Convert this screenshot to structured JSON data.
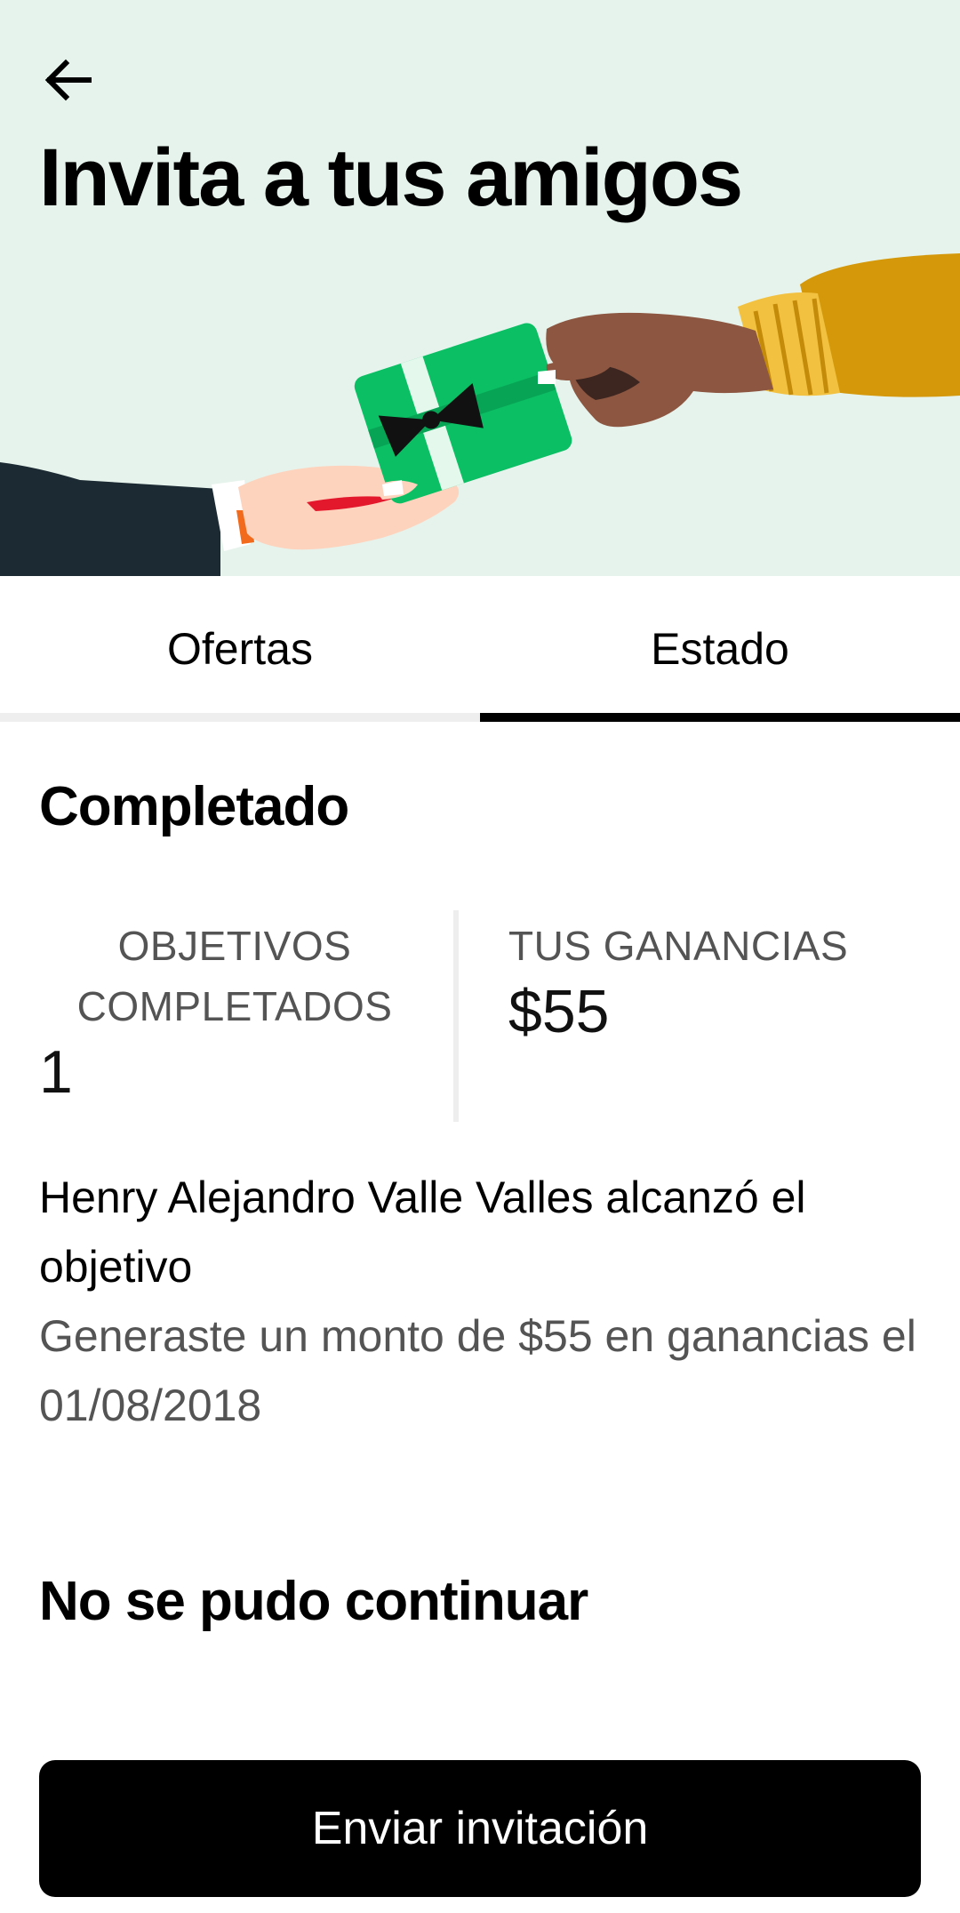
{
  "header": {
    "back_icon": "arrow-left-icon",
    "title": "Invita a tus amigos",
    "background_color": "#e6f3ec"
  },
  "tabs": [
    {
      "label": "Ofertas",
      "active": false
    },
    {
      "label": "Estado",
      "active": true
    }
  ],
  "completed_section": {
    "heading": "Completado",
    "stats": {
      "goals_label": "OBJETIVOS COMPLETADOS",
      "goals_value": "1",
      "earnings_label": "TUS GANANCIAS",
      "earnings_value": "$55"
    },
    "referral": {
      "title": "Henry Alejandro Valle Valles alcanzó el objetivo",
      "detail": "Generaste un monto de $55 en ganancias el 01/08/2018"
    }
  },
  "failed_section": {
    "heading": "No se pudo continuar"
  },
  "cta": {
    "label": "Enviar invitación"
  },
  "colors": {
    "gift_green": "#0bbf64",
    "sleeve_yellow": "#d4980a",
    "suit_dark": "#1c2a33",
    "secondary_text": "#545454"
  }
}
